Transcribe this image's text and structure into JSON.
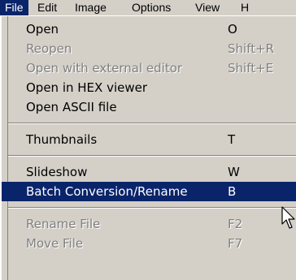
{
  "menubar": {
    "items": [
      {
        "label": "File"
      },
      {
        "label": "Edit"
      },
      {
        "label": "Image"
      },
      {
        "label": "Options"
      },
      {
        "label": "View"
      },
      {
        "label": "H"
      }
    ]
  },
  "file_menu": {
    "items": [
      {
        "label": "Open",
        "shortcut": "O",
        "enabled": true
      },
      {
        "label": "Reopen",
        "shortcut": "Shift+R",
        "enabled": false
      },
      {
        "label": "Open with external editor",
        "shortcut": "Shift+E",
        "enabled": false
      },
      {
        "label": "Open in HEX viewer",
        "shortcut": "",
        "enabled": true
      },
      {
        "label": "Open ASCII file",
        "shortcut": "",
        "enabled": true
      },
      {
        "label": "Thumbnails",
        "shortcut": "T",
        "enabled": true
      },
      {
        "label": "Slideshow",
        "shortcut": "W",
        "enabled": true
      },
      {
        "label": "Batch Conversion/Rename",
        "shortcut": "B",
        "enabled": true,
        "highlighted": true
      },
      {
        "label": "Rename File",
        "shortcut": "F2",
        "enabled": false
      },
      {
        "label": "Move File",
        "shortcut": "F7",
        "enabled": false
      }
    ]
  },
  "colors": {
    "menu_background": "#d4d0c8",
    "highlight_background": "#0a246a",
    "highlight_text": "#ffffff",
    "disabled_text": "#808080"
  },
  "icons": {
    "cursor": "arrow-cursor-icon"
  }
}
